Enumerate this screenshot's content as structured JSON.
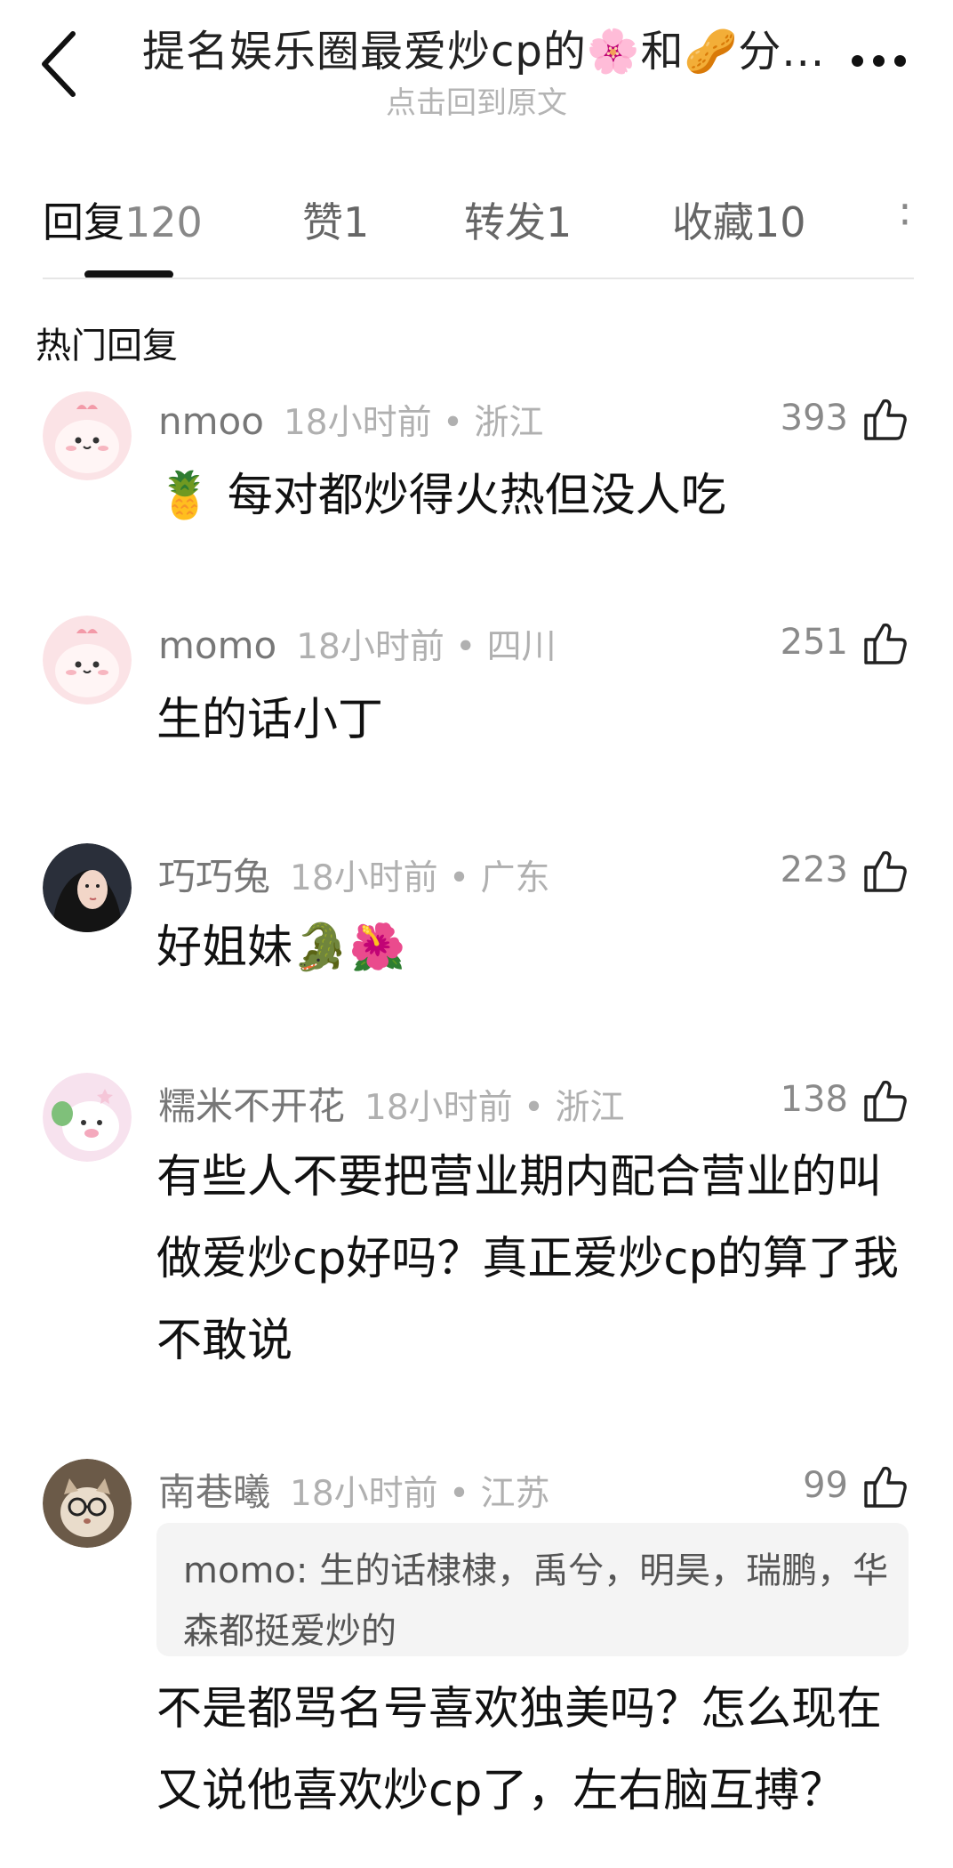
{
  "header": {
    "title": "提名娱乐圈最爱炒cp的🌸和🥜分...",
    "subtitle": "点击回到原文"
  },
  "tabs": [
    {
      "label": "回复",
      "count": "120"
    },
    {
      "label": "赞",
      "count": "1"
    },
    {
      "label": "转发",
      "count": "1"
    },
    {
      "label": "收藏",
      "count": "10"
    }
  ],
  "section_title": "热门回复",
  "comments": [
    {
      "name": "nmoo",
      "time": "18小时前 • 浙江",
      "likes": "393",
      "text": "🍍 每对都炒得火热但没人吃",
      "avatar": "pink-chick-avatar"
    },
    {
      "name": "momo",
      "time": "18小时前 • 四川",
      "likes": "251",
      "text": "生的话小丁",
      "avatar": "pink-chick-avatar"
    },
    {
      "name": "巧巧兔",
      "time": "18小时前 • 广东",
      "likes": "223",
      "text": "好姐妹🐊🌺",
      "avatar": "girl-photo-avatar"
    },
    {
      "name": "糯米不开花",
      "time": "18小时前 • 浙江",
      "likes": "138",
      "text": "有些人不要把营业期内配合营业的叫做爱炒cp好吗？真正爱炒cp的算了我不敢说",
      "avatar": "pink-pig-avatar"
    },
    {
      "name": "南巷曦",
      "time": "18小时前 • 江苏",
      "likes": "99",
      "quote": "momo: 生的话棣棣，禹兮，明昊，瑞鹏，华森都挺爱炒的",
      "text": "不是都骂名号喜欢独美吗？怎么现在又说他喜欢炒cp了，左右脑互搏？",
      "avatar": "cat-with-glasses-avatar"
    }
  ],
  "colors": {
    "accent": "#111111",
    "muted": "#777777",
    "meta": "#b0b0b0",
    "quote_bg": "#f4f4f4"
  }
}
